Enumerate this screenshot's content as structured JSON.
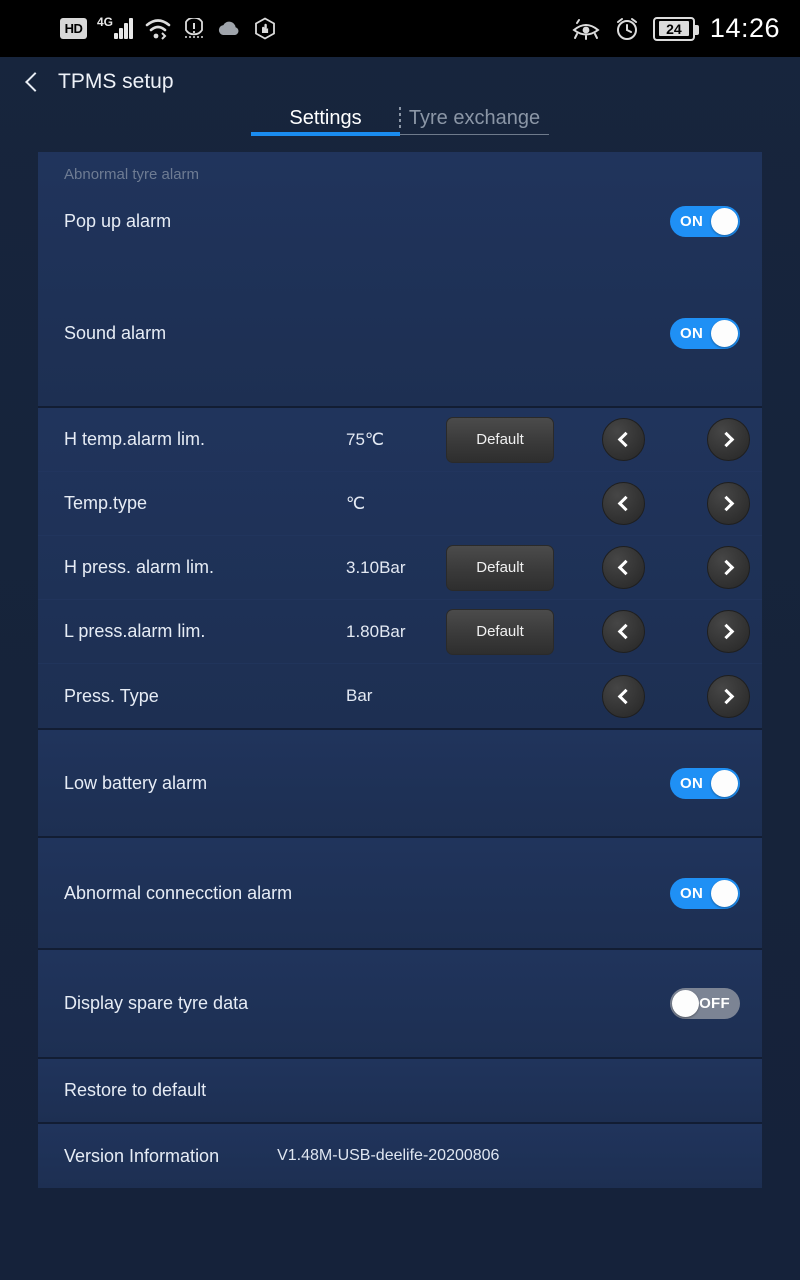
{
  "status_bar": {
    "hd_label": "HD",
    "network_label": "4G",
    "icons": [
      "hd-icon",
      "signal-icon",
      "wifi-icon",
      "tyre-pressure-warning-icon",
      "cloud-icon",
      "hand-brake-icon",
      "eye-off-icon",
      "alarm-clock-icon"
    ],
    "battery_level": "24",
    "time": "14:26"
  },
  "header": {
    "back_icon": "back-chevron-icon",
    "title": "TPMS setup"
  },
  "tabs": [
    {
      "label": "Settings",
      "active": true
    },
    {
      "label": "Tyre exchange",
      "active": false
    }
  ],
  "groups": [
    {
      "title": "Abnormal tyre alarm",
      "rows": [
        {
          "label": "Pop up alarm",
          "toggle": "ON"
        },
        {
          "label": "Sound alarm",
          "toggle": "ON"
        }
      ]
    },
    {
      "rows": [
        {
          "label": "H temp.alarm lim.",
          "value": "75℃",
          "default_label": "Default",
          "prev": "‹",
          "next": "›"
        },
        {
          "label": "Temp.type",
          "value": "℃",
          "prev": "‹",
          "next": "›"
        },
        {
          "label": "H press. alarm lim.",
          "value": "3.10Bar",
          "default_label": "Default",
          "prev": "‹",
          "next": "›"
        },
        {
          "label": "L press.alarm lim.",
          "value": "1.80Bar",
          "default_label": "Default",
          "prev": "‹",
          "next": "›"
        },
        {
          "label": "Press. Type",
          "value": "Bar",
          "prev": "‹",
          "next": "›"
        }
      ]
    },
    {
      "rows": [
        {
          "label": "Low battery alarm",
          "toggle": "ON"
        }
      ]
    },
    {
      "rows": [
        {
          "label": "Abnormal connecction alarm",
          "toggle": "ON"
        }
      ]
    },
    {
      "rows": [
        {
          "label": "Display spare tyre data",
          "toggle": "OFF"
        }
      ]
    },
    {
      "rows": [
        {
          "label": "Restore to default"
        }
      ]
    },
    {
      "rows": [
        {
          "label": "Version Information",
          "version": "V1.48M-USB-deelife-20200806"
        }
      ]
    }
  ],
  "colors": {
    "accent": "#1a8cf0",
    "toggle_on": "#1f90f5",
    "toggle_off": "#7c8494",
    "panel_bg": "#20345c",
    "page_bg": "#16233a"
  }
}
